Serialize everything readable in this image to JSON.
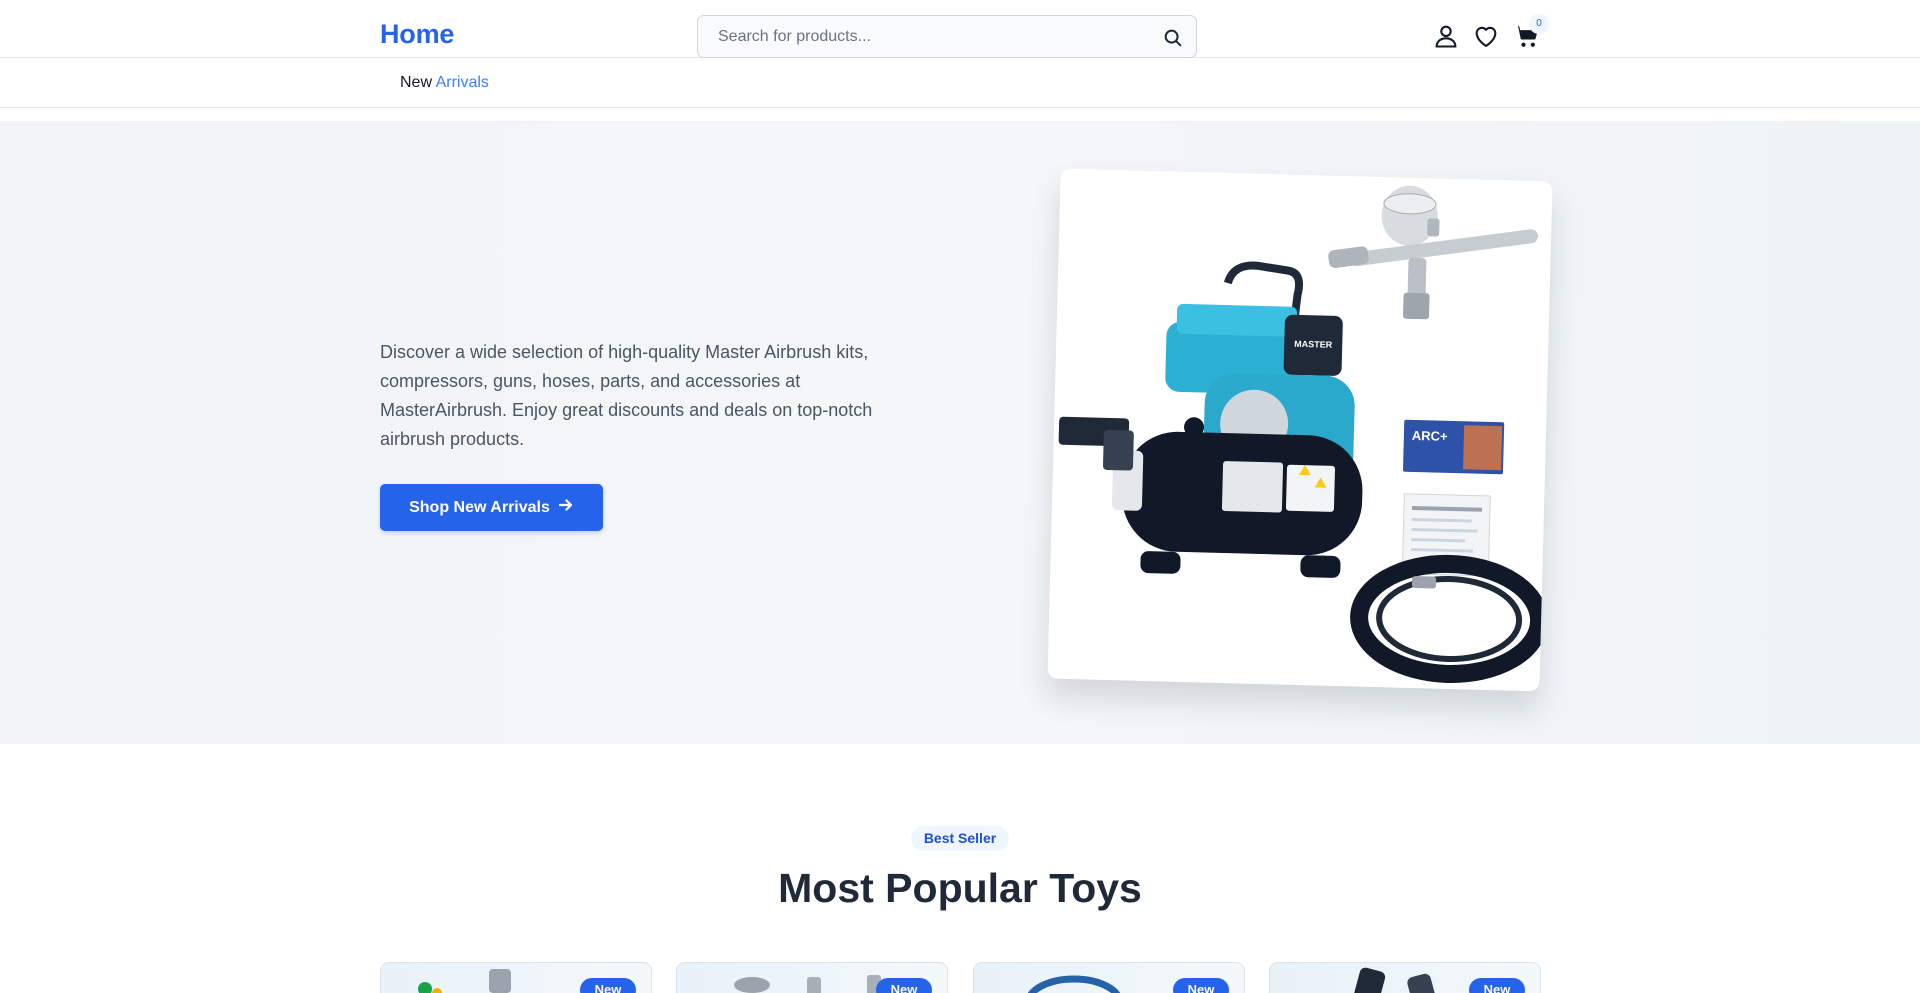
{
  "header": {
    "logo": "Home",
    "search": {
      "placeholder": "Search for products...",
      "value": ""
    },
    "icons": [
      "user-icon",
      "heart-icon",
      "cart-icon",
      "search-icon"
    ],
    "cart_count": "0"
  },
  "subnav": {
    "link_prefix": "New",
    "link_accent": "Arrivals"
  },
  "hero": {
    "description": "Discover a wide selection of high-quality Master Airbrush kits, compressors, guns, hoses, parts, and accessories at MasterAirbrush. Enjoy great discounts and deals on top-notch airbrush products.",
    "cta_label": "Shop New Arrivals",
    "cta_icon": "arrow-right-icon",
    "image_label": "MASTER",
    "box_label": "ARC+"
  },
  "bestsellers": {
    "pill": "Best Seller",
    "title": "Most Popular Toys",
    "cards": [
      {
        "badge": "New"
      },
      {
        "badge": "New"
      },
      {
        "badge": "New"
      },
      {
        "badge": "New"
      }
    ]
  },
  "colors": {
    "brand": "#2563eb",
    "accent_link": "#3b82f6",
    "compressor_teal": "#2bb0d4",
    "hero_bg": "#f3f5f7"
  }
}
